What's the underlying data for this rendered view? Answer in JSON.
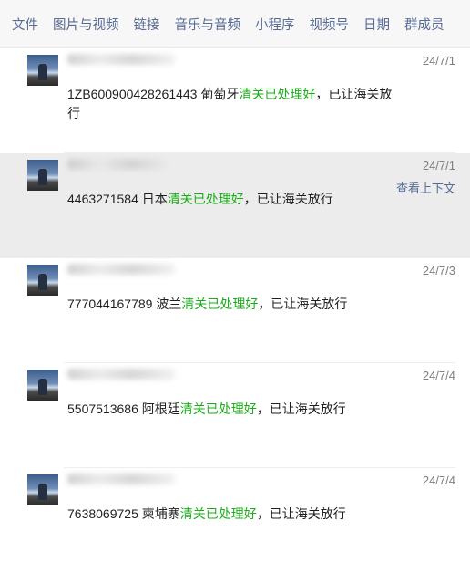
{
  "tabs": [
    "文件",
    "图片与视频",
    "链接",
    "音乐与音频",
    "小程序",
    "视频号",
    "日期",
    "群成员"
  ],
  "context_link": "查看上下文",
  "messages": [
    {
      "date": "24/7/1",
      "prefix": "1ZB600900428261443 葡萄牙",
      "highlight": "清关已处理好",
      "suffix": "，已让海关放行",
      "selected": false
    },
    {
      "date": "24/7/1",
      "prefix": "4463271584 日本",
      "highlight": "清关已处理好",
      "suffix": "，已让海关放行",
      "selected": true
    },
    {
      "date": "24/7/3",
      "prefix": "777044167789 波兰",
      "highlight": "清关已处理好",
      "suffix": "，已让海关放行",
      "selected": false
    },
    {
      "date": "24/7/4",
      "prefix": "5507513686 阿根廷",
      "highlight": "清关已处理好",
      "suffix": "，已让海关放行",
      "selected": false
    },
    {
      "date": "24/7/4",
      "prefix": "7638069725  柬埔寨",
      "highlight": "清关已处理好",
      "suffix": "，已让海关放行",
      "selected": false
    }
  ],
  "colors": {
    "link": "#576b95",
    "highlight": "#1aad19",
    "selected_bg": "#ececec"
  }
}
